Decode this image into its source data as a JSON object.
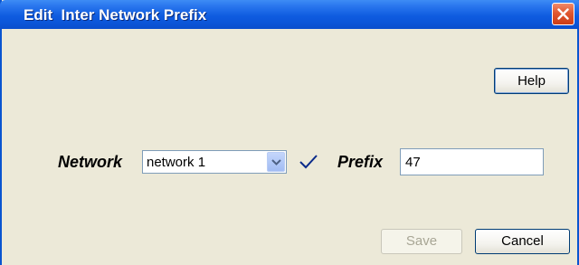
{
  "window": {
    "title": "Edit  Inter Network Prefix"
  },
  "buttons": {
    "help": "Help",
    "save": "Save",
    "cancel": "Cancel"
  },
  "form": {
    "network_label": "Network",
    "network_value": "network 1",
    "prefix_label": "Prefix",
    "prefix_value": "47"
  },
  "icons": {
    "close": "close-icon",
    "dropdown": "chevron-down-icon",
    "valid": "checkmark-icon"
  },
  "colors": {
    "titlebar": "#0b55d8",
    "close": "#e0572f",
    "check": "#0a2a8a"
  },
  "state": {
    "save_enabled": false
  }
}
